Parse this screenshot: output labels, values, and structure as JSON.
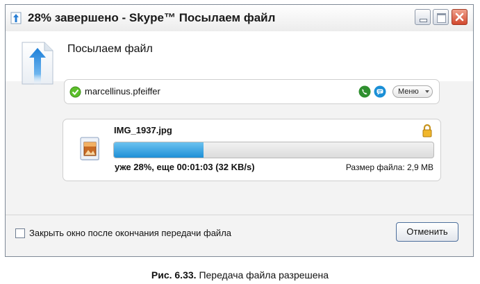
{
  "window": {
    "title": "28% завершено - Skype™ Посылаем файл",
    "header_title": "Посылаем файл"
  },
  "contact": {
    "name": "marcellinus.pfeiffer",
    "menu_label": "Меню"
  },
  "transfer": {
    "file_name": "IMG_1937.jpg",
    "progress_percent": 28,
    "status_text": "уже 28%, еще 00:01:03  (32 KB/s)",
    "file_size_text": "Размер файла: 2,9 MB"
  },
  "footer": {
    "close_checkbox_label": "Закрыть окно после окончания передачи файла",
    "close_checkbox_checked": false,
    "cancel_label": "Отменить"
  },
  "caption": {
    "number": "Рис. 6.33.",
    "text": "Передача файла разрешена"
  },
  "colors": {
    "progress_fill": "#1e8fd6",
    "status_online": "#5cbf2a",
    "call_button": "#2f8f2f",
    "chat_button": "#1a8fd6",
    "close_button": "#d2492f"
  },
  "icons": {
    "title": "upload-arrow-icon",
    "header": "upload-document-icon",
    "status": "online-status-icon",
    "call": "call-icon",
    "chat": "chat-icon",
    "file": "image-file-icon",
    "lock": "lock-icon"
  }
}
